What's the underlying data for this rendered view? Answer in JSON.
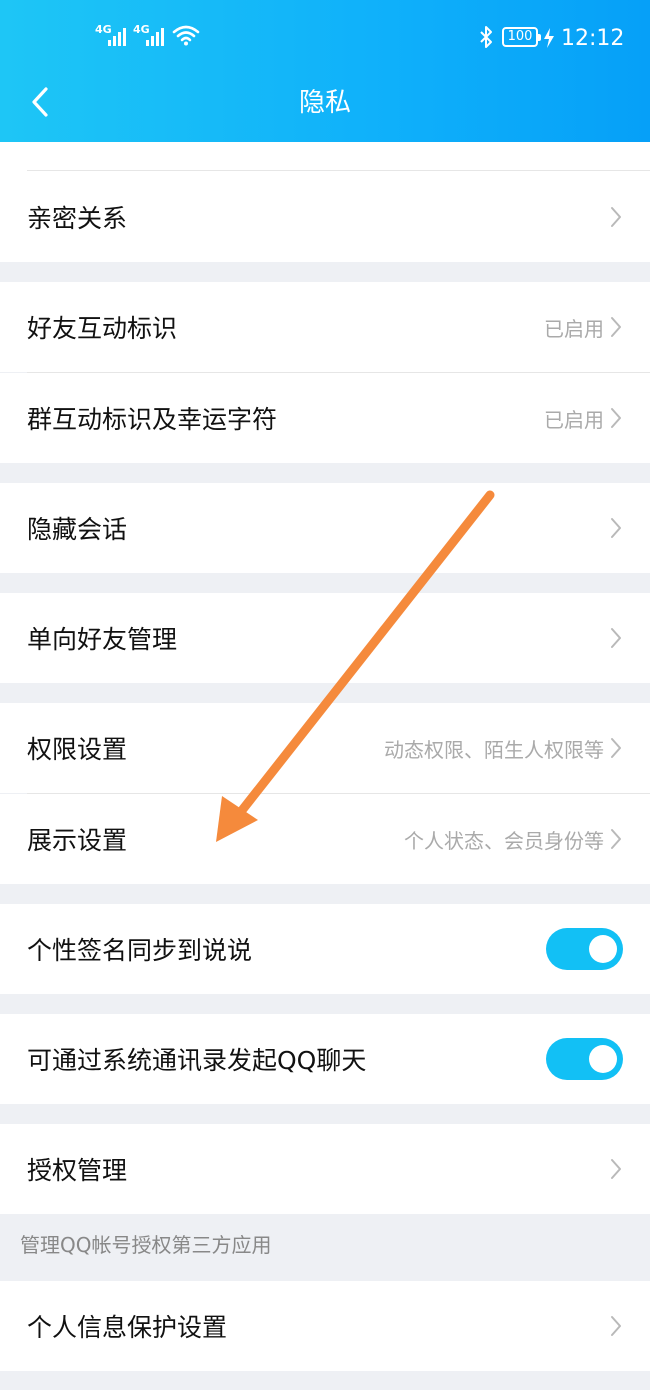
{
  "status_bar": {
    "sim1": "4G",
    "sim2": "4G",
    "wifi_icon": "wifi-icon",
    "bluetooth_icon": "bluetooth-icon",
    "battery": "100",
    "charging_icon": "bolt-icon",
    "time": "12:12"
  },
  "header": {
    "back_icon": "chevron-left-icon",
    "title": "隐私",
    "gradient_start": "#1ec6f6",
    "gradient_end": "#06a0f8"
  },
  "items": [
    {
      "label": "亲密关系",
      "value": ""
    },
    {
      "label": "好友互动标识",
      "value": "已启用"
    },
    {
      "label": "群互动标识及幸运字符",
      "value": "已启用"
    },
    {
      "label": "隐藏会话",
      "value": ""
    },
    {
      "label": "单向好友管理",
      "value": ""
    },
    {
      "label": "权限设置",
      "value": "动态权限、陌生人权限等"
    },
    {
      "label": "展示设置",
      "value": "个人状态、会员身份等"
    },
    {
      "label": "个性签名同步到说说",
      "toggle": true
    },
    {
      "label": "可通过系统通讯录发起QQ聊天",
      "toggle": true
    },
    {
      "label": "授权管理",
      "value": ""
    },
    {
      "label": "个人信息保护设置",
      "value": ""
    }
  ],
  "authorization_note": "管理QQ帐号授权第三方应用",
  "colors": {
    "toggle_on": "#12c0f5",
    "annotation_arrow": "#f58a3c",
    "page_background": "#eef0f4"
  }
}
